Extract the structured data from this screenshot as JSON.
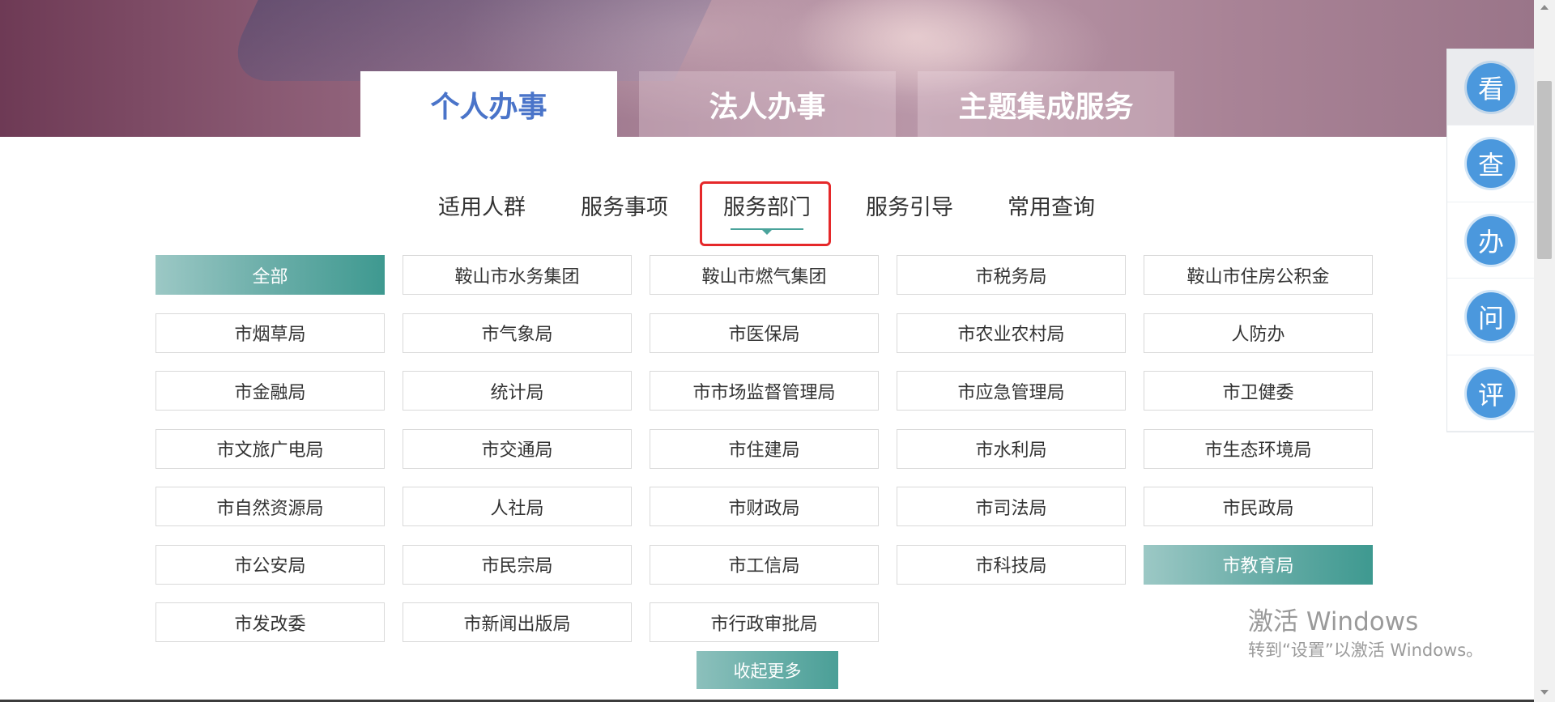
{
  "top_tabs": [
    {
      "label": "个人办事",
      "active": true
    },
    {
      "label": "法人办事",
      "active": false
    },
    {
      "label": "主题集成服务",
      "active": false
    }
  ],
  "sub_tabs": [
    {
      "label": "适用人群",
      "active": false
    },
    {
      "label": "服务事项",
      "active": false
    },
    {
      "label": "服务部门",
      "active": true
    },
    {
      "label": "服务引导",
      "active": false
    },
    {
      "label": "常用查询",
      "active": false
    }
  ],
  "departments": [
    {
      "label": "全部",
      "selected": true
    },
    {
      "label": "鞍山市水务集团",
      "selected": false
    },
    {
      "label": "鞍山市燃气集团",
      "selected": false
    },
    {
      "label": "市税务局",
      "selected": false
    },
    {
      "label": "鞍山市住房公积金",
      "selected": false
    },
    {
      "label": "市烟草局",
      "selected": false
    },
    {
      "label": "市气象局",
      "selected": false
    },
    {
      "label": "市医保局",
      "selected": false
    },
    {
      "label": "市农业农村局",
      "selected": false
    },
    {
      "label": "人防办",
      "selected": false
    },
    {
      "label": "市金融局",
      "selected": false
    },
    {
      "label": "统计局",
      "selected": false
    },
    {
      "label": "市市场监督管理局",
      "selected": false
    },
    {
      "label": "市应急管理局",
      "selected": false
    },
    {
      "label": "市卫健委",
      "selected": false
    },
    {
      "label": "市文旅广电局",
      "selected": false
    },
    {
      "label": "市交通局",
      "selected": false
    },
    {
      "label": "市住建局",
      "selected": false
    },
    {
      "label": "市水利局",
      "selected": false
    },
    {
      "label": "市生态环境局",
      "selected": false
    },
    {
      "label": "市自然资源局",
      "selected": false
    },
    {
      "label": "人社局",
      "selected": false
    },
    {
      "label": "市财政局",
      "selected": false
    },
    {
      "label": "市司法局",
      "selected": false
    },
    {
      "label": "市民政局",
      "selected": false
    },
    {
      "label": "市公安局",
      "selected": false
    },
    {
      "label": "市民宗局",
      "selected": false
    },
    {
      "label": "市工信局",
      "selected": false
    },
    {
      "label": "市科技局",
      "selected": false
    },
    {
      "label": "市教育局",
      "selected": true
    },
    {
      "label": "市发改委",
      "selected": false
    },
    {
      "label": "市新闻出版局",
      "selected": false
    },
    {
      "label": "市行政审批局",
      "selected": false
    }
  ],
  "collapse_button": "收起更多",
  "sidebar": [
    {
      "label": "看",
      "name": "look"
    },
    {
      "label": "查",
      "name": "search"
    },
    {
      "label": "办",
      "name": "handle"
    },
    {
      "label": "问",
      "name": "ask"
    },
    {
      "label": "评",
      "name": "evaluate"
    }
  ],
  "watermark": {
    "line1": "激活 Windows",
    "line2": "转到“设置”以激活 Windows。"
  },
  "colors": {
    "accent_blue": "#4a74c9",
    "teal": "#4a9f97",
    "highlight_red": "#e5282a",
    "side_circle": "#4b98dd"
  }
}
